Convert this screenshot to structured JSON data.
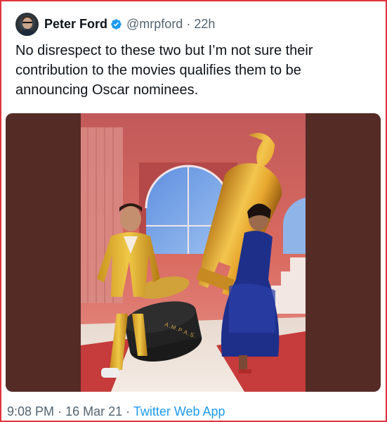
{
  "tweet": {
    "author": {
      "display_name": "Peter Ford",
      "handle": "@mrpford",
      "verified": true,
      "avatar_icon": "profile-photo"
    },
    "separator": "·",
    "relative_time": "22h",
    "text": "No disrespect to these two but I’m not sure their contribution to the movies qualifies them to be announcing Oscar nominees.",
    "media": {
      "type": "photo",
      "statue_inscription": "A.M.P.A.S."
    },
    "footer": {
      "time": "9:08 PM",
      "date": "16 Mar 21",
      "separator": "·",
      "source_app": "Twitter Web App"
    }
  },
  "colors": {
    "frame_border": "#e0343c",
    "link_blue": "#1d9bf0",
    "muted_gray": "#536471",
    "text_black": "#0f1419",
    "media_side_panel": "#552b26"
  }
}
